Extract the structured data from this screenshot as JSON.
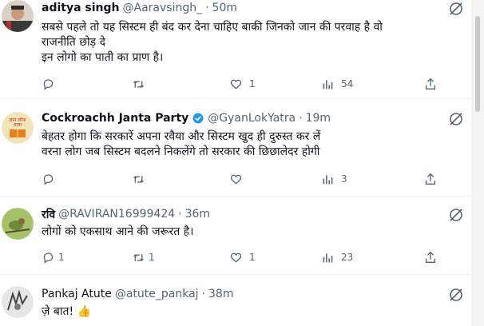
{
  "tweets": [
    {
      "name": "aditya singh",
      "handle": "@Aaravsingh_",
      "time": "50m",
      "lines": [
        "सबसे पहले तो यह सिस्टम ही बंद कर देना चाहिए बाकी जिनको जान की परवाह है वो",
        "राजनीति छोड़ दे",
        "इन लोगो का पाती का प्राण है।"
      ],
      "replies": "",
      "retweets": "",
      "likes": "1",
      "views": "54"
    },
    {
      "name": "Cockroachh Janta Party",
      "handle": "@GyanLokYatra",
      "time": "19m",
      "verified": true,
      "lines": [
        "बेहतर होगा कि सरकारें अपना रवैया और सिस्टम खुद ही दुरुस्त कर लें",
        "वरना लोग जब सिस्टम बदलने निकलेंगे तो सरकार की छिछालेदर होगी"
      ],
      "replies": "",
      "retweets": "",
      "likes": "",
      "views": "3"
    },
    {
      "name": "रवि",
      "handle": "@RAVIRAN16999424",
      "time": "36m",
      "lines": [
        "लोगों को एकसाथ आने की जरूरत है।"
      ],
      "replies": "1",
      "retweets": "1",
      "likes": "1",
      "views": "23"
    },
    {
      "name": "Pankaj Atute",
      "handle": "@atute_pankaj",
      "time": "38m",
      "lines": [
        "ज़े बात! 👍"
      ]
    }
  ],
  "colors": {
    "text": "#0f1419",
    "muted": "#536471",
    "verified": "#1d9bf0",
    "divider": "#eff3f4"
  },
  "icons": [
    "more-icon",
    "reply-icon",
    "retweet-icon",
    "like-icon",
    "views-icon",
    "bookmark-icon",
    "share-icon",
    "verified-icon"
  ]
}
